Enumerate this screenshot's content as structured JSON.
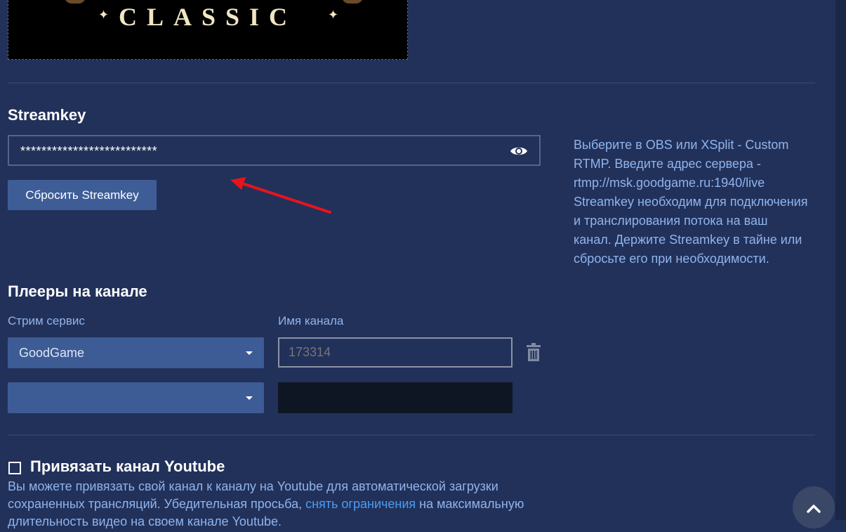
{
  "banner": {
    "text": "CLASSIC",
    "left_mark": "✦",
    "right_mark": "✦"
  },
  "streamkey": {
    "title": "Streamkey",
    "masked_value": "**************************",
    "reset_label": "Сбросить Streamkey",
    "help_lines": [
      "Выберите в OBS или XSplit - Custom",
      "RTMP. Введите адрес сервера -",
      "rtmp://msk.goodgame.ru:1940/live",
      "Streamkey необходим для подключения",
      "и транслирования потока на ваш",
      "канал. Держите Streamkey в тайне или",
      "сбросьте его при необходимости."
    ]
  },
  "players": {
    "title": "Плееры на канале",
    "service_label": "Стрим сервис",
    "channel_label": "Имя канала",
    "rows": [
      {
        "service": "GoodGame",
        "channel_placeholder": "173314"
      },
      {
        "service": "",
        "channel_placeholder": ""
      }
    ]
  },
  "youtube": {
    "title": "Привязать канал Youtube",
    "desc_part1": "Вы можете привязать свой канал к каналу на Youtube для автоматической загрузки сохраненных трансляций. Убедительная просьба, ",
    "desc_link": "снять ограничения",
    "desc_part2": " на максимальную длительность видео на своем канале Youtube."
  },
  "icons": {
    "eye": "eye-icon",
    "trash": "trash-icon",
    "caret": "chevron-down-icon",
    "scroll_top": "chevron-up-icon"
  },
  "colors": {
    "background": "#22315a",
    "button": "#3e5d97",
    "help_text": "#8fb4ec",
    "link": "#4b9df0",
    "annotation_arrow": "#e8141b"
  }
}
